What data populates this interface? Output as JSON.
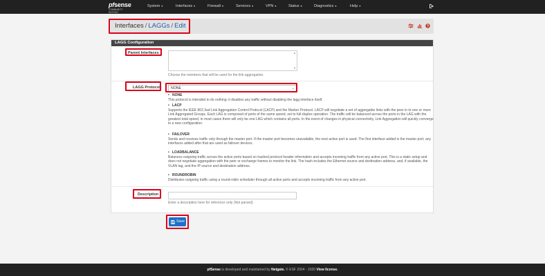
{
  "navbar": {
    "brand_pf": "pf",
    "brand_sense": "sense",
    "edition": "COMMUNITY EDITION",
    "menus": [
      "System",
      "Interfaces",
      "Firewall",
      "Services",
      "VPN",
      "Status",
      "Diagnostics",
      "Help"
    ],
    "caret": "▾",
    "logout_icon": "logout-icon"
  },
  "breadcrumb": {
    "root": "Interfaces",
    "section": "LAGGs",
    "current": "Edit",
    "separator": "/"
  },
  "panel": {
    "title": "LAGG Configuration",
    "parent_interfaces": {
      "label": "Parent Interfaces",
      "help": "Choose the members that will be used for the link aggregation."
    },
    "lagg_protocol": {
      "label": "LAGG Protocol",
      "selected": "NONE",
      "options_help": [
        {
          "name": "NONE",
          "desc": "This protocol is intended to do nothing: it disables any traffic without disabling the lagg interface itself."
        },
        {
          "name": "LACP",
          "desc": "Supports the IEEE 802.3ad Link Aggregation Control Protocol (LACP) and the Marker Protocol. LACP will negotiate a set of aggregable links with the peer in to one or more Link Aggregated Groups. Each LAG is composed of ports of the same speed, set to full-duplex operation. The traffic will be balanced across the ports in the LAG with the greatest total speed, in most cases there will only be one LAG which contains all ports. In the event of changes in physical connectivity, Link Aggregation will quickly converge to a new configuration."
        },
        {
          "name": "FAILOVER",
          "desc": "Sends and receives traffic only through the master port. If the master port becomes unavailable, the next active port is used. The first interface added is the master port; any interfaces added after that are used as failover devices."
        },
        {
          "name": "LOADBALANCE",
          "desc": "Balances outgoing traffic across the active ports based on hashed protocol header information and accepts incoming traffic from any active port. This is a static setup and does not negotiate aggregation with the peer or exchange frames to monitor the link. The hash includes the Ethernet source and destination address, and, if available, the VLAN tag, and the IP source and destination address."
        },
        {
          "name": "ROUNDROBIN",
          "desc": "Distributes outgoing traffic using a round-robin scheduler through all active ports and accepts incoming traffic from any active port."
        }
      ]
    },
    "description": {
      "label": "Description",
      "value": "",
      "help": "Enter a description here for reference only (Not parsed)."
    }
  },
  "save_label": "Save",
  "footer": {
    "brand": "pfSense",
    "text1": " is developed and maintained by ",
    "company": "Netgate.",
    "text2": " © ESF 2004 - 2020 ",
    "license": "View license."
  },
  "colors": {
    "navbar": "#212121",
    "panel_header": "#444444",
    "link": "#1e5fa8",
    "primary_button": "#1d6fc7",
    "highlight": "#d9001b"
  }
}
